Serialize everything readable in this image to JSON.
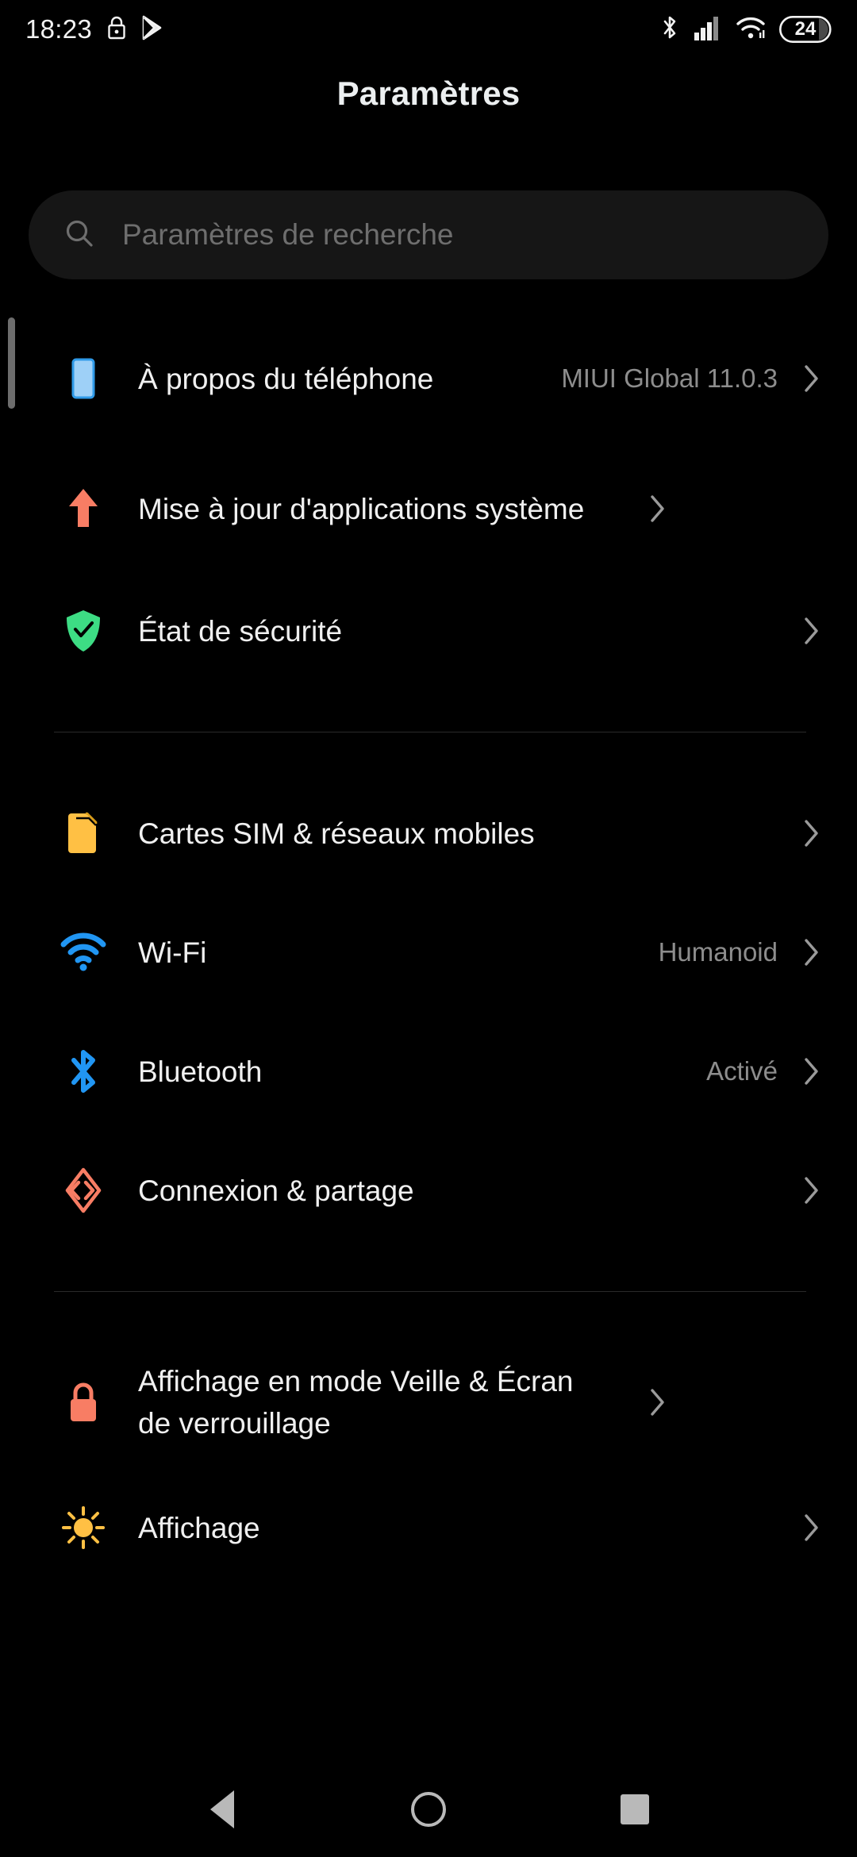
{
  "status_bar": {
    "clock": "18:23",
    "left_icons": [
      "lock-icon",
      "play-store-icon"
    ],
    "right_icons": [
      "bluetooth-icon",
      "cellular-signal-icon",
      "wifi-icon"
    ],
    "battery_level": "24"
  },
  "header": {
    "title": "Paramètres"
  },
  "search": {
    "placeholder": "Paramètres de recherche",
    "value": "",
    "icon": "search-icon"
  },
  "groups": [
    {
      "id": "device-info",
      "items": [
        {
          "label": "À propos du téléphone",
          "value": "MIUI Global 11.0.3",
          "icon": "phone-info-icon",
          "icon_color": "#8ec7f5"
        },
        {
          "label": "Mise à jour d'applications système",
          "value": "",
          "icon": "system-update-arrow-icon",
          "icon_color": "#f87d64"
        },
        {
          "label": "État de sécurité",
          "value": "",
          "icon": "security-shield-check-icon",
          "icon_color": "#3ddc84"
        }
      ]
    },
    {
      "id": "connectivity",
      "items": [
        {
          "label": "Cartes SIM & réseaux mobiles",
          "value": "",
          "icon": "sim-card-icon",
          "icon_color": "#ffc044"
        },
        {
          "label": "Wi-Fi",
          "value": "Humanoid",
          "icon": "wifi-icon",
          "icon_color": "#2196f3"
        },
        {
          "label": "Bluetooth",
          "value": "Activé",
          "icon": "bluetooth-icon",
          "icon_color": "#2196f3"
        },
        {
          "label": "Connexion & partage",
          "value": "",
          "icon": "connection-sharing-icon",
          "icon_color": "#f87d64"
        }
      ]
    },
    {
      "id": "display",
      "items": [
        {
          "label": "Affichage en mode Veille & Écran de verrouillage",
          "value": "",
          "icon": "lock-screen-padlock-icon",
          "icon_color": "#f87d64"
        },
        {
          "label": "Affichage",
          "value": "",
          "icon": "brightness-sun-icon",
          "icon_color": "#ffc044"
        }
      ]
    }
  ],
  "nav_bar": {
    "back": "back-button",
    "home": "home-button",
    "recents": "recents-button"
  },
  "colors": {
    "background": "#000000",
    "search_field": "#161616",
    "primary_text": "#f0f0f0",
    "secondary_text": "#8d8d8d",
    "divider": "#2a2a2a"
  }
}
